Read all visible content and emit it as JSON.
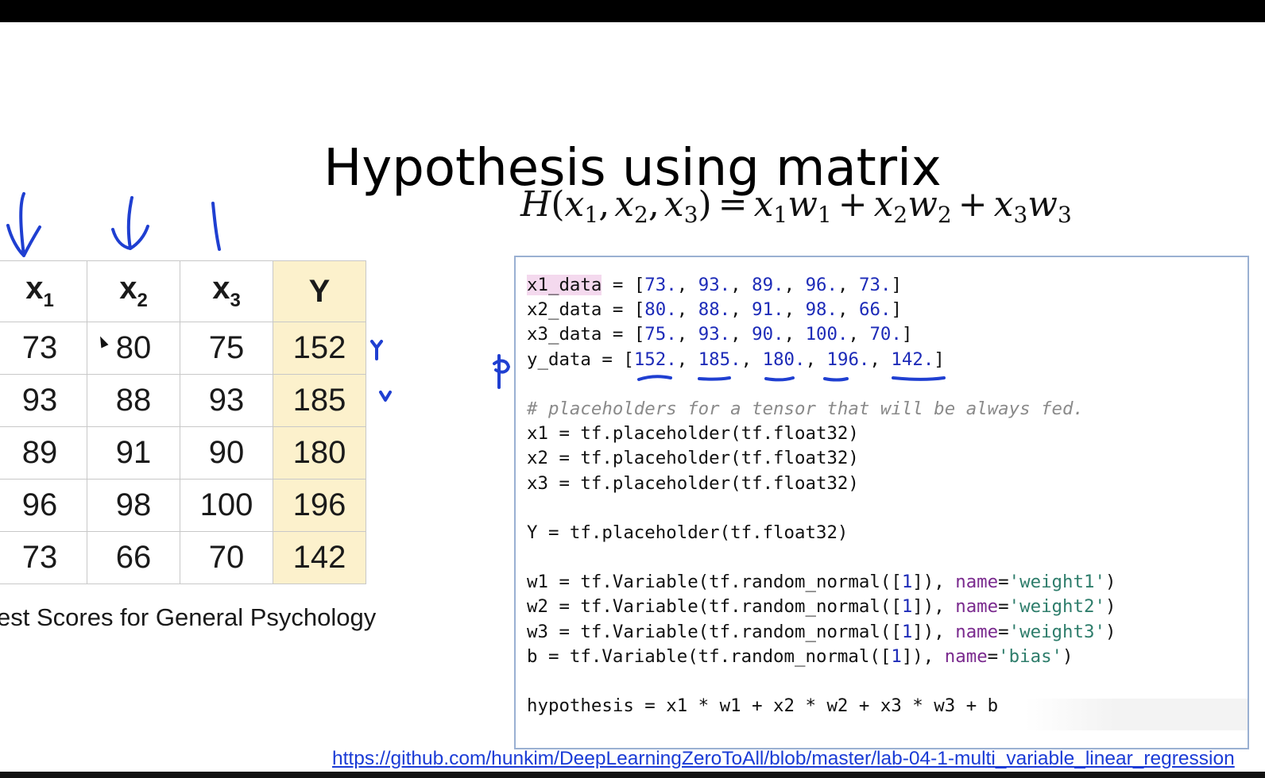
{
  "slide": {
    "title": "Hypothesis using matrix",
    "formula": {
      "lhs_fn": "H",
      "args": [
        {
          "var": "x",
          "sub": "1"
        },
        {
          "var": "x",
          "sub": "2"
        },
        {
          "var": "x",
          "sub": "3"
        }
      ],
      "terms": [
        {
          "x": "x",
          "xsub": "1",
          "w": "w",
          "wsub": "1"
        },
        {
          "x": "x",
          "xsub": "2",
          "w": "w",
          "wsub": "2"
        },
        {
          "x": "x",
          "xsub": "3",
          "w": "w",
          "wsub": "3"
        }
      ]
    }
  },
  "table": {
    "headers": [
      {
        "base": "x",
        "sub": "1"
      },
      {
        "base": "x",
        "sub": "2"
      },
      {
        "base": "x",
        "sub": "3"
      },
      {
        "base": "Y",
        "sub": ""
      }
    ],
    "rows": [
      [
        "73",
        "80",
        "75",
        "152"
      ],
      [
        "93",
        "88",
        "93",
        "185"
      ],
      [
        "89",
        "91",
        "90",
        "180"
      ],
      [
        "96",
        "98",
        "100",
        "196"
      ],
      [
        "73",
        "66",
        "70",
        "142"
      ]
    ],
    "caption": "est Scores for General Psychology"
  },
  "code": {
    "line_x1": {
      "name": "x1_data",
      "rest": " = [",
      "vals": [
        "73.",
        "93.",
        "89.",
        "96.",
        "73."
      ],
      "end": "]"
    },
    "line_x2": {
      "name": "x2_data",
      "rest": " = [",
      "vals": [
        "80.",
        "88.",
        "91.",
        "98.",
        "66."
      ],
      "end": "]"
    },
    "line_x3": {
      "name": "x3_data",
      "rest": " = [",
      "vals": [
        "75.",
        "93.",
        "90.",
        "100.",
        "70."
      ],
      "end": "]"
    },
    "line_y": {
      "name": "y_data",
      "rest": " = [",
      "vals": [
        "152.",
        "185.",
        "180.",
        "196.",
        "142."
      ],
      "end": "]"
    },
    "comment": "# placeholders for a tensor that will be always fed.",
    "ph1": "x1 = tf.placeholder(tf.float32)",
    "ph2": "x2 = tf.placeholder(tf.float32)",
    "ph3": "x3 = tf.placeholder(tf.float32)",
    "phy": "Y = tf.placeholder(tf.float32)",
    "w1": {
      "pre": "w1 = tf.Variable(tf.random_normal([",
      "num": "1",
      "mid": "]), ",
      "kw": "name",
      "eq": "=",
      "str": "'weight1'",
      "end": ")"
    },
    "w2": {
      "pre": "w2 = tf.Variable(tf.random_normal([",
      "num": "1",
      "mid": "]), ",
      "kw": "name",
      "eq": "=",
      "str": "'weight2'",
      "end": ")"
    },
    "w3": {
      "pre": "w3 = tf.Variable(tf.random_normal([",
      "num": "1",
      "mid": "]), ",
      "kw": "name",
      "eq": "=",
      "str": "'weight3'",
      "end": ")"
    },
    "b": {
      "pre": "b = tf.Variable(tf.random_normal([",
      "num": "1",
      "mid": "]), ",
      "kw": "name",
      "eq": "=",
      "str": "'bias'",
      "end": ")"
    },
    "hypothesis": "hypothesis = x1 * w1 + x2 * w2 + x3 * w3 + b"
  },
  "source_link": "https://github.com/hunkim/DeepLearningZeroToAll/blob/master/lab-04-1-multi_variable_linear_regression",
  "colors": {
    "ink": "#1f3fd1",
    "y_column": "#fcf1cc",
    "code_number": "#1d2bb8",
    "code_keyword": "#7a2a8e",
    "code_string": "#2e7d6b",
    "code_comment": "#8a8a8a",
    "link": "#1a3bd6"
  }
}
